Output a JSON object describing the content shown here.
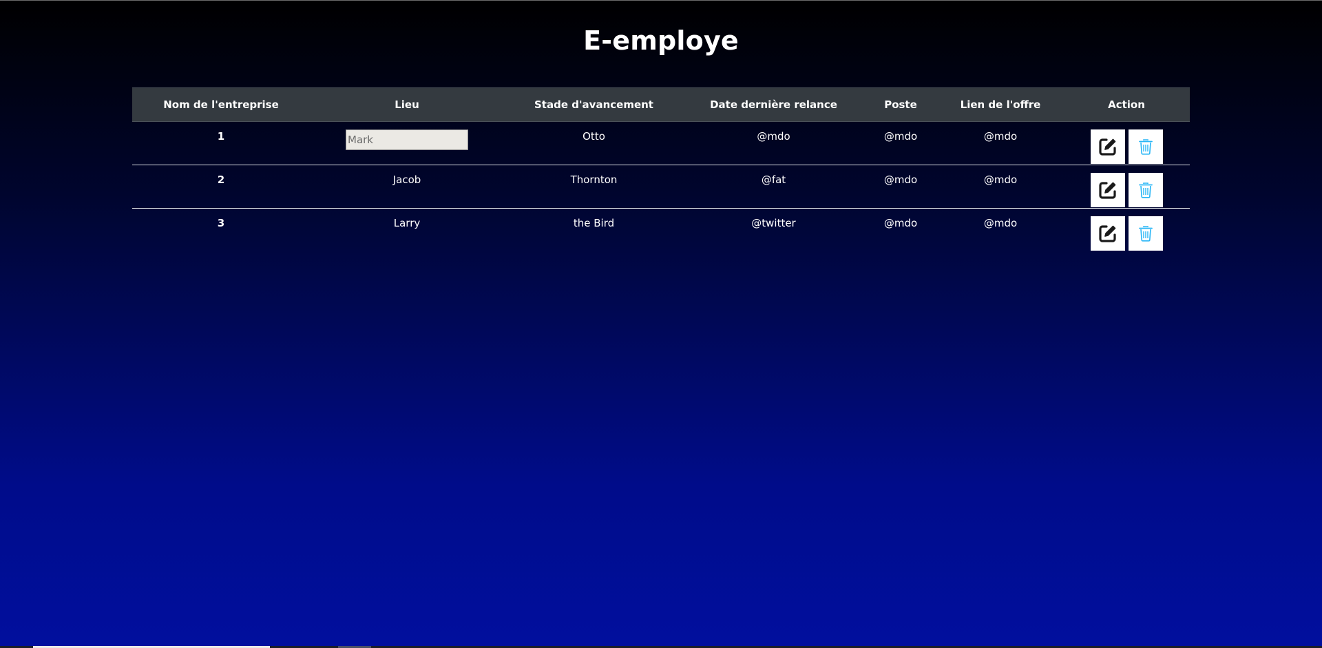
{
  "page": {
    "title": "E-employe"
  },
  "table": {
    "headers": [
      "Nom de l'entreprise",
      "Lieu",
      "Stade d'avancement",
      "Date dernière relance",
      "Poste",
      "Lien de l'offre",
      "Action"
    ],
    "rows": [
      {
        "id": "1",
        "lieu_input_placeholder": "Mark",
        "stade": "Otto",
        "date": "@mdo",
        "poste": "@mdo",
        "lien": "@mdo"
      },
      {
        "id": "2",
        "lieu": "Jacob",
        "stade": "Thornton",
        "date": "@fat",
        "poste": "@mdo",
        "lien": "@mdo"
      },
      {
        "id": "3",
        "lieu": "Larry",
        "stade": "the Bird",
        "date": "@twitter",
        "poste": "@mdo",
        "lien": "@mdo"
      }
    ]
  },
  "icons": {
    "edit": "edit-icon",
    "delete": "trash-icon"
  },
  "colors": {
    "header_bg": "#343a40",
    "trash_icon": "#29b6f6",
    "edit_icon": "#1a1a1a",
    "background_top": "#000000",
    "background_bottom": "#010f9e"
  }
}
